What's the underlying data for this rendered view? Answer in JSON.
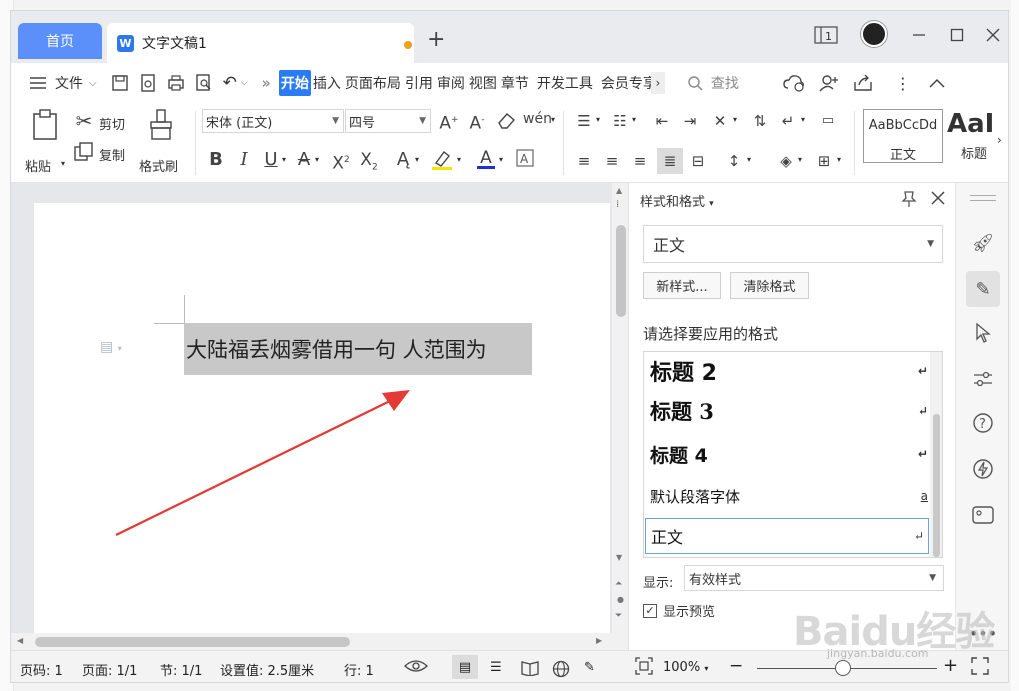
{
  "tabs": {
    "home": "首页",
    "document": "文字文稿1"
  },
  "window_icons": {
    "page_count_icon": "1"
  },
  "menu": {
    "file": "文件",
    "items": [
      "开始",
      "插入",
      "页面布局",
      "引用",
      "审阅",
      "视图",
      "章节",
      "开发工具",
      "会员专享"
    ],
    "search": "查找"
  },
  "ribbon": {
    "paste": "粘贴",
    "cut": "剪切",
    "copy": "复制",
    "format_painter": "格式刷",
    "font_name": "宋体 (正文)",
    "font_size": "四号",
    "style_preview_normal": "AaBbCcDd",
    "style_normal": "正文",
    "style_preview_heading": "AaI",
    "style_heading": "标题"
  },
  "document": {
    "selected_text": "大陆福丢烟雾借用一句 人范围为"
  },
  "panel": {
    "title": "样式和格式",
    "current_style": "正文",
    "new_style_button": "新样式...",
    "clear_format_button": "清除格式",
    "choose_label": "请选择要应用的格式",
    "styles": [
      {
        "label": "标题  2",
        "mark": "↵"
      },
      {
        "label": "标题  3",
        "mark": "↵"
      },
      {
        "label": "标题  4",
        "mark": "↵"
      },
      {
        "label": "默认段落字体",
        "mark": "a"
      },
      {
        "label": "正文",
        "mark": "↵"
      }
    ],
    "show_label": "显示:",
    "show_value": "有效样式",
    "preview_label": "显示预览",
    "preview_checked": true
  },
  "status": {
    "page_num": "页码: 1",
    "pages": "页面: 1/1",
    "section": "节: 1/1",
    "setting": "设置值: 2.5厘米",
    "line": "行: 1",
    "zoom": "100%"
  },
  "watermark": {
    "logo": "Baidu经验",
    "url": "jingyan.baidu.com"
  },
  "colors": {
    "accent": "#2b7bf6",
    "home_tab": "#5b8ff9",
    "arrow": "#e53935",
    "selection": "#c8c8c8"
  }
}
